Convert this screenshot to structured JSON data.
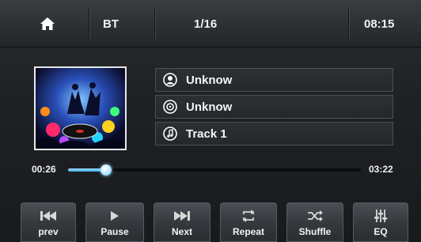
{
  "topbar": {
    "home_icon": "home-icon",
    "source": "BT",
    "track_count": "1/16",
    "clock": "08:15"
  },
  "album_art": {
    "description_icon": "album-art-image"
  },
  "info": {
    "artist": {
      "icon": "artist-icon",
      "text": "Unknow"
    },
    "album": {
      "icon": "disc-icon",
      "text": "Unknow"
    },
    "title": {
      "icon": "music-note-icon",
      "text": "Track 1"
    }
  },
  "progress": {
    "elapsed": "00:26",
    "total": "03:22",
    "fraction": 0.13,
    "accent": "#3aa8e0"
  },
  "controls": {
    "prev": "prev",
    "pause": "Pause",
    "next": "Next",
    "repeat": "Repeat",
    "shuffle": "Shuffle",
    "eq": "EQ"
  }
}
